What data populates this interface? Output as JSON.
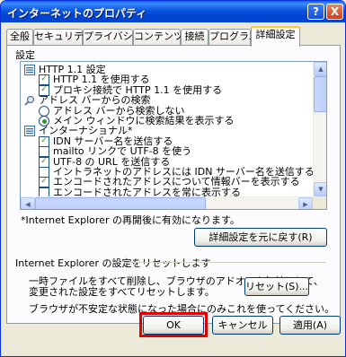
{
  "window": {
    "title": "インターネットのプロパティ",
    "help_btn": "?",
    "close_btn": "X"
  },
  "tabs": [
    {
      "label": "全般"
    },
    {
      "label": "セキュリティ"
    },
    {
      "label": "プライバシー"
    },
    {
      "label": "コンテンツ"
    },
    {
      "label": "接続"
    },
    {
      "label": "プログラム"
    },
    {
      "label": "詳細設定"
    }
  ],
  "settings": {
    "header": "設定",
    "items": [
      {
        "kind": "folder",
        "label": "HTTP 1.1 設定",
        "indent": 0
      },
      {
        "kind": "checkbox",
        "checked": true,
        "label": "HTTP 1.1 を使用する",
        "indent": 1
      },
      {
        "kind": "checkbox",
        "checked": true,
        "label": "プロキシ接続で HTTP 1.1 を使用する",
        "indent": 1
      },
      {
        "kind": "search",
        "label": "アドレス バーからの検索",
        "indent": 0
      },
      {
        "kind": "radio",
        "checked": false,
        "label": "アドレス バーから検索しない",
        "indent": 1
      },
      {
        "kind": "radio",
        "checked": true,
        "label": "メイン ウィンドウに検索結果を表示する",
        "indent": 1
      },
      {
        "kind": "folder",
        "label": "インターナショナル*",
        "indent": 0
      },
      {
        "kind": "checkbox",
        "checked": true,
        "label": "IDN サーバー名を送信する",
        "indent": 1
      },
      {
        "kind": "checkbox",
        "checked": false,
        "label": "mailto リンクで UTF-8 を使う",
        "indent": 1
      },
      {
        "kind": "checkbox",
        "checked": true,
        "label": "UTF-8 の URL を送信する",
        "indent": 1
      },
      {
        "kind": "checkbox",
        "checked": false,
        "label": "イントラネットのアドレスには IDN サーバー名を送信する",
        "indent": 1
      },
      {
        "kind": "checkbox",
        "checked": true,
        "label": "エンコードされたアドレスについて情報バーを表示する",
        "indent": 1
      },
      {
        "kind": "checkbox",
        "checked": false,
        "label": "エンコードされたアドレスを常に表示する",
        "indent": 1
      }
    ],
    "note": "*Internet Explorer の再開後に有効になります。",
    "restore_btn": "詳細設定を元に戻す(R)"
  },
  "reset": {
    "group_title": "Internet Explorer の設定をリセットします",
    "desc_line1": "一時ファイルをすべて削除し、ブラウザのアドオンを無効にして、",
    "desc_line2": "変更された設定をすべてリセットします。",
    "reset_btn": "リセット(S)...",
    "warning": "ブラウザが不安定な状態になった場合にのみこれを使ってください。"
  },
  "footer": {
    "ok_btn": "OK",
    "cancel_btn": "キャンセル",
    "apply_btn": "適用(A)"
  },
  "colors": {
    "highlight": "#E00000",
    "titlebar": "#0054E3",
    "check": "#21A121"
  }
}
